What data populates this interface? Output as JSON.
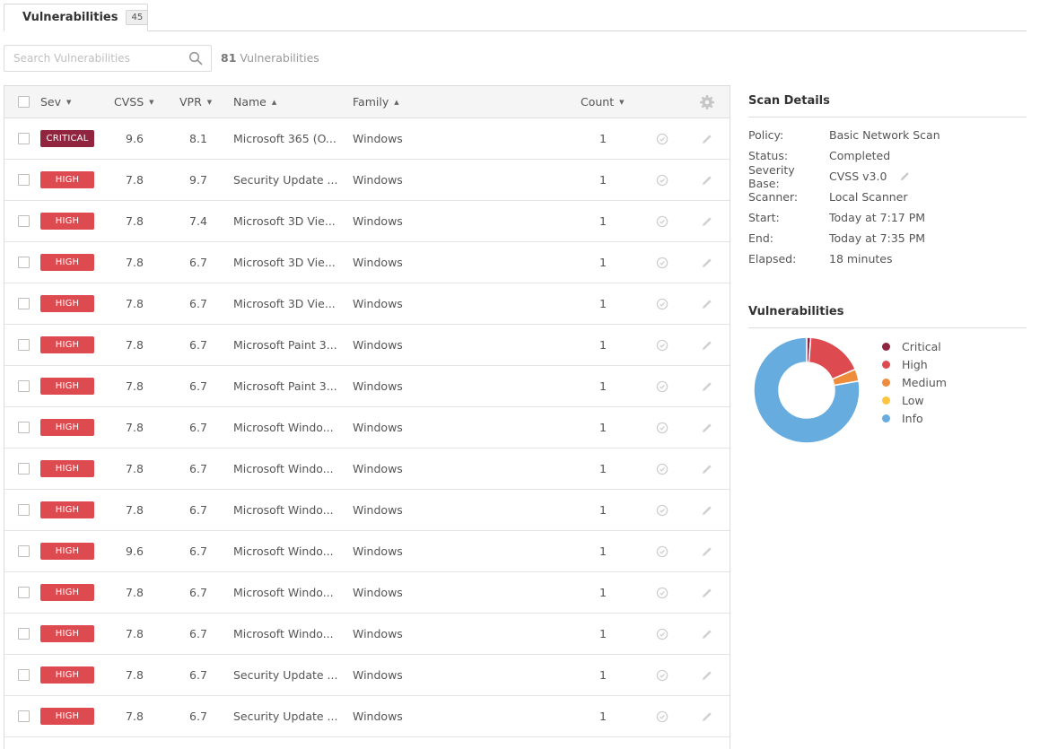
{
  "tab": {
    "label": "Vulnerabilities",
    "count": "45"
  },
  "search": {
    "placeholder": "Search Vulnerabilities",
    "total_count": "81",
    "total_label": " Vulnerabilities"
  },
  "table": {
    "headers": {
      "sev": "Sev",
      "cvss": "CVSS",
      "vpr": "VPR",
      "name": "Name",
      "family": "Family",
      "count": "Count"
    },
    "rows": [
      {
        "sev": "CRITICAL",
        "level": "critical",
        "cvss": "9.6",
        "vpr": "8.1",
        "name": "Microsoft 365 (O...",
        "family": "Windows",
        "count": "1"
      },
      {
        "sev": "HIGH",
        "level": "high",
        "cvss": "7.8",
        "vpr": "9.7",
        "name": "Security Update ...",
        "family": "Windows",
        "count": "1"
      },
      {
        "sev": "HIGH",
        "level": "high",
        "cvss": "7.8",
        "vpr": "7.4",
        "name": "Microsoft 3D Vie...",
        "family": "Windows",
        "count": "1"
      },
      {
        "sev": "HIGH",
        "level": "high",
        "cvss": "7.8",
        "vpr": "6.7",
        "name": "Microsoft 3D Vie...",
        "family": "Windows",
        "count": "1"
      },
      {
        "sev": "HIGH",
        "level": "high",
        "cvss": "7.8",
        "vpr": "6.7",
        "name": "Microsoft 3D Vie...",
        "family": "Windows",
        "count": "1"
      },
      {
        "sev": "HIGH",
        "level": "high",
        "cvss": "7.8",
        "vpr": "6.7",
        "name": "Microsoft Paint 3...",
        "family": "Windows",
        "count": "1"
      },
      {
        "sev": "HIGH",
        "level": "high",
        "cvss": "7.8",
        "vpr": "6.7",
        "name": "Microsoft Paint 3...",
        "family": "Windows",
        "count": "1"
      },
      {
        "sev": "HIGH",
        "level": "high",
        "cvss": "7.8",
        "vpr": "6.7",
        "name": "Microsoft Windo...",
        "family": "Windows",
        "count": "1"
      },
      {
        "sev": "HIGH",
        "level": "high",
        "cvss": "7.8",
        "vpr": "6.7",
        "name": "Microsoft Windo...",
        "family": "Windows",
        "count": "1"
      },
      {
        "sev": "HIGH",
        "level": "high",
        "cvss": "7.8",
        "vpr": "6.7",
        "name": "Microsoft Windo...",
        "family": "Windows",
        "count": "1"
      },
      {
        "sev": "HIGH",
        "level": "high",
        "cvss": "9.6",
        "vpr": "6.7",
        "name": "Microsoft Windo...",
        "family": "Windows",
        "count": "1"
      },
      {
        "sev": "HIGH",
        "level": "high",
        "cvss": "7.8",
        "vpr": "6.7",
        "name": "Microsoft Windo...",
        "family": "Windows",
        "count": "1"
      },
      {
        "sev": "HIGH",
        "level": "high",
        "cvss": "7.8",
        "vpr": "6.7",
        "name": "Microsoft Windo...",
        "family": "Windows",
        "count": "1"
      },
      {
        "sev": "HIGH",
        "level": "high",
        "cvss": "7.8",
        "vpr": "6.7",
        "name": "Security Update ...",
        "family": "Windows",
        "count": "1"
      },
      {
        "sev": "HIGH",
        "level": "high",
        "cvss": "7.8",
        "vpr": "6.7",
        "name": "Security Update ...",
        "family": "Windows",
        "count": "1"
      }
    ]
  },
  "scan_details": {
    "title": "Scan Details",
    "items": [
      {
        "label": "Policy:",
        "value": "Basic Network Scan"
      },
      {
        "label": "Status:",
        "value": "Completed"
      },
      {
        "label": "Severity Base:",
        "value": "CVSS v3.0"
      },
      {
        "label": "Scanner:",
        "value": "Local Scanner"
      },
      {
        "label": "Start:",
        "value": "Today at 7:17 PM"
      },
      {
        "label": "End:",
        "value": "Today at 7:35 PM"
      },
      {
        "label": "Elapsed:",
        "value": "18 minutes"
      }
    ]
  },
  "vulnerabilities_panel": {
    "title": "Vulnerabilities",
    "legend": [
      {
        "label": "Critical",
        "color": "#91243e"
      },
      {
        "label": "High",
        "color": "#dd4b50"
      },
      {
        "label": "Medium",
        "color": "#ee8c3c"
      },
      {
        "label": "Low",
        "color": "#fdc43f"
      },
      {
        "label": "Info",
        "color": "#67acdf"
      }
    ],
    "donut_share": {
      "critical": 1,
      "high": 14,
      "medium": 3,
      "low": 0,
      "info": 63
    }
  },
  "colors": {
    "critical": "#91243e",
    "high": "#dd4b50",
    "icon_gray": "#c8c8c8"
  }
}
